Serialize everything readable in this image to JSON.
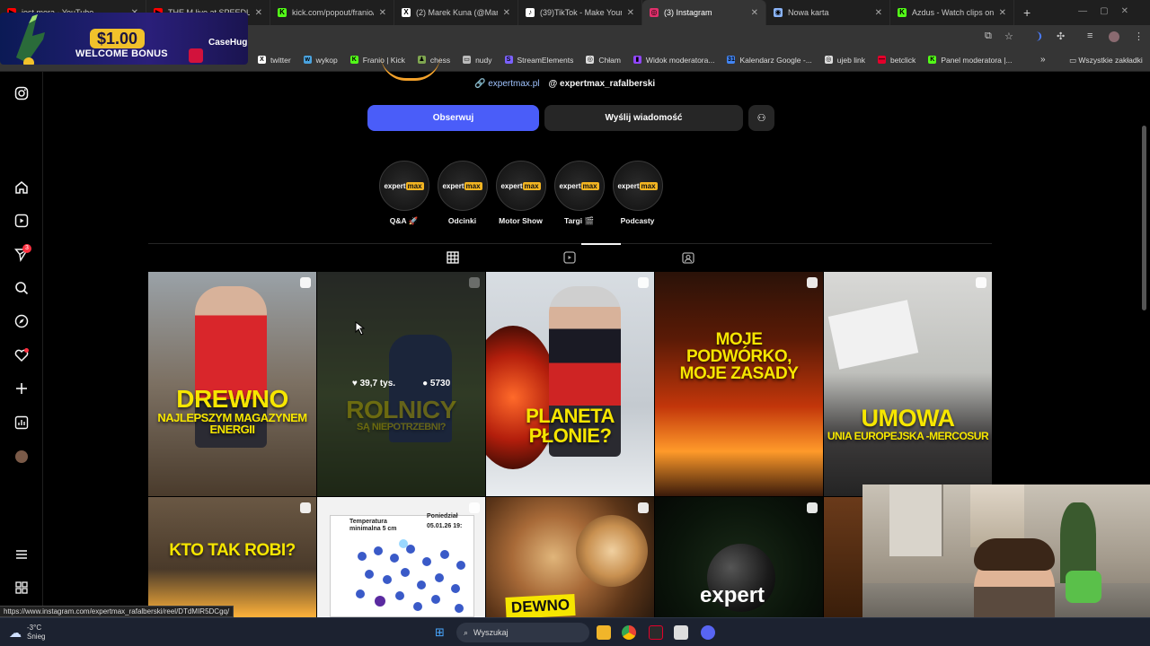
{
  "browser": {
    "tabs": [
      {
        "title": "jest mera - YouTube",
        "fav_color": "#ff0000",
        "fav": "▶"
      },
      {
        "title": "THE M live at SPEEDLANE",
        "fav_color": "#ff0000",
        "fav": "▶"
      },
      {
        "title": "kick.com/popout/franio/c",
        "fav_color": "#53fc18",
        "fav": "K"
      },
      {
        "title": "(2) Marek Kuna (@Marek",
        "fav_color": "#ffffff",
        "fav": "X"
      },
      {
        "title": "(39)TikTok - Make Your D",
        "fav_color": "#ffffff",
        "fav": "♪"
      },
      {
        "title": "(3) Instagram",
        "fav_color": "#e1306c",
        "fav": "◎"
      },
      {
        "title": "Nowa karta",
        "fav_color": "#8ab4f8",
        "fav": "◉"
      },
      {
        "title": "Azdus - Watch clips on K",
        "fav_color": "#53fc18",
        "fav": "K"
      }
    ],
    "active_tab_index": 5,
    "bookmarks": [
      {
        "label": "twitter",
        "color": "#ffffff",
        "icon": "X"
      },
      {
        "label": "wykop",
        "color": "#4aa3df",
        "icon": "w"
      },
      {
        "label": "Franio | Kick",
        "color": "#53fc18",
        "icon": "K"
      },
      {
        "label": "chess",
        "color": "#7fa650",
        "icon": "♟"
      },
      {
        "label": "nudy",
        "color": "#bbbbbb",
        "icon": "▭"
      },
      {
        "label": "StreamElements",
        "color": "#7b61ff",
        "icon": "S"
      },
      {
        "label": "Chłam",
        "color": "#dddddd",
        "icon": "◎"
      },
      {
        "label": "Widok moderatora...",
        "color": "#9146ff",
        "icon": "▮"
      },
      {
        "label": "Kalendarz Google -...",
        "color": "#4285f4",
        "icon": "31"
      },
      {
        "label": "ujeb link",
        "color": "#dddddd",
        "icon": "◎"
      },
      {
        "label": "betclick",
        "color": "#e4002b",
        "icon": "—"
      },
      {
        "label": "Panel moderatora |...",
        "color": "#53fc18",
        "icon": "K"
      }
    ],
    "all_bookmarks": "Wszystkie zakładki"
  },
  "promo": {
    "amount": "$1.00",
    "text": "WELCOME BONUS",
    "brand": "CaseHug"
  },
  "profile": {
    "website": "expertmax.pl",
    "threads": "expertmax_rafalberski",
    "follow": "Obserwuj",
    "message": "Wyślij wiadomość",
    "highlights": [
      {
        "label": "Q&A 🚀"
      },
      {
        "label": "Odcinki"
      },
      {
        "label": "Motor Show"
      },
      {
        "label": "Targi 🎬"
      },
      {
        "label": "Podcasty"
      }
    ],
    "highlight_logo": {
      "pre": "expert",
      "box": "max"
    }
  },
  "posts": [
    {
      "caption": "DREWNO",
      "sub": "NAJLEPSZYM MAGAZYNEM ENERGII"
    },
    {
      "caption": "ROLNICY",
      "sub": "SĄ NIEPOTRZEBNI?",
      "likes": "39,7 tys.",
      "comments": "5730"
    },
    {
      "caption": "PLANETA PŁONIE?",
      "sub": ""
    },
    {
      "caption": "MOJE PODWÓRKO, MOJE ZASADY",
      "sub": ""
    },
    {
      "caption": "UMOWA",
      "sub": "UNIA EUROPEJSKA -MERCOSUR"
    },
    {
      "caption": "KTO TAK ROBI?",
      "sub": ""
    },
    {
      "caption": "Temperatura minimalna 5 cm",
      "sub": "Poniedział 05.01.26 19:"
    },
    {
      "caption": "DEWNO",
      "sub": ""
    },
    {
      "caption": "expert",
      "sub": ""
    }
  ],
  "status_url": "https://www.instagram.com/expertmax_rafalberski/reel/DTdMIR5DCgq/",
  "taskbar": {
    "weather_temp": "-3°C",
    "weather_desc": "Śnieg",
    "search": "Wyszukaj"
  },
  "colors": {
    "accent": "#4a5df9",
    "secondary_btn": "#262626",
    "caption_yellow": "#f6e600"
  }
}
